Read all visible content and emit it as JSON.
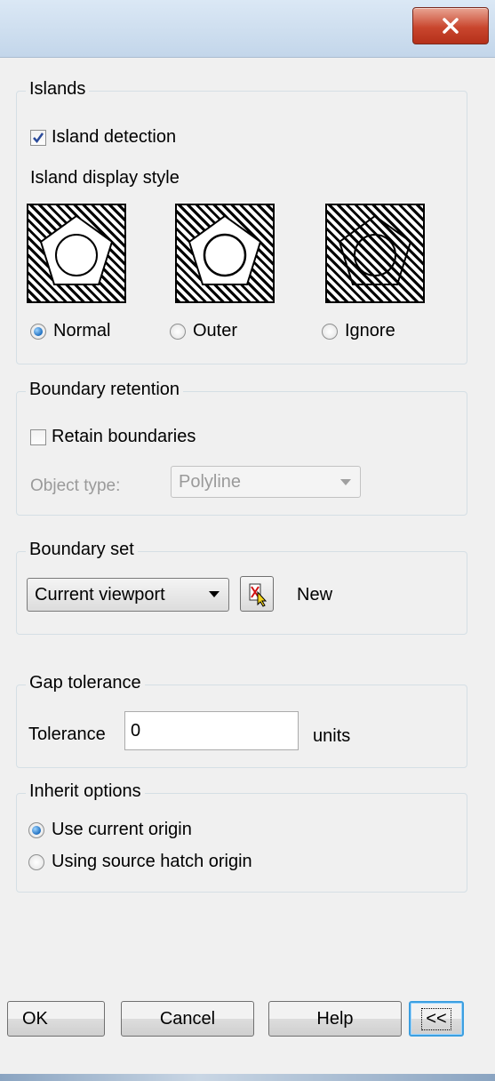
{
  "islands": {
    "legend": "Islands",
    "detection_label": "Island detection",
    "detection_checked": true,
    "display_style_label": "Island display style",
    "styles": [
      {
        "label": "Normal",
        "selected": true
      },
      {
        "label": "Outer",
        "selected": false
      },
      {
        "label": "Ignore",
        "selected": false
      }
    ]
  },
  "boundary_retention": {
    "legend": "Boundary retention",
    "retain_label": "Retain boundaries",
    "retain_checked": false,
    "object_type_label": "Object type:",
    "object_type_value": "Polyline"
  },
  "boundary_set": {
    "legend": "Boundary set",
    "selected": "Current viewport",
    "new_label": "New"
  },
  "gap_tolerance": {
    "legend": "Gap tolerance",
    "tolerance_label": "Tolerance",
    "tolerance_value": "0",
    "units_label": "units"
  },
  "inherit_options": {
    "legend": "Inherit options",
    "options": [
      {
        "label": "Use current origin",
        "selected": true
      },
      {
        "label": "Using source hatch origin",
        "selected": false
      }
    ]
  },
  "buttons": {
    "ok": "OK",
    "cancel": "Cancel",
    "help": "Help",
    "collapse": "<<"
  },
  "colors": {
    "accent": "#1f6fc0",
    "close": "#c9462e"
  }
}
